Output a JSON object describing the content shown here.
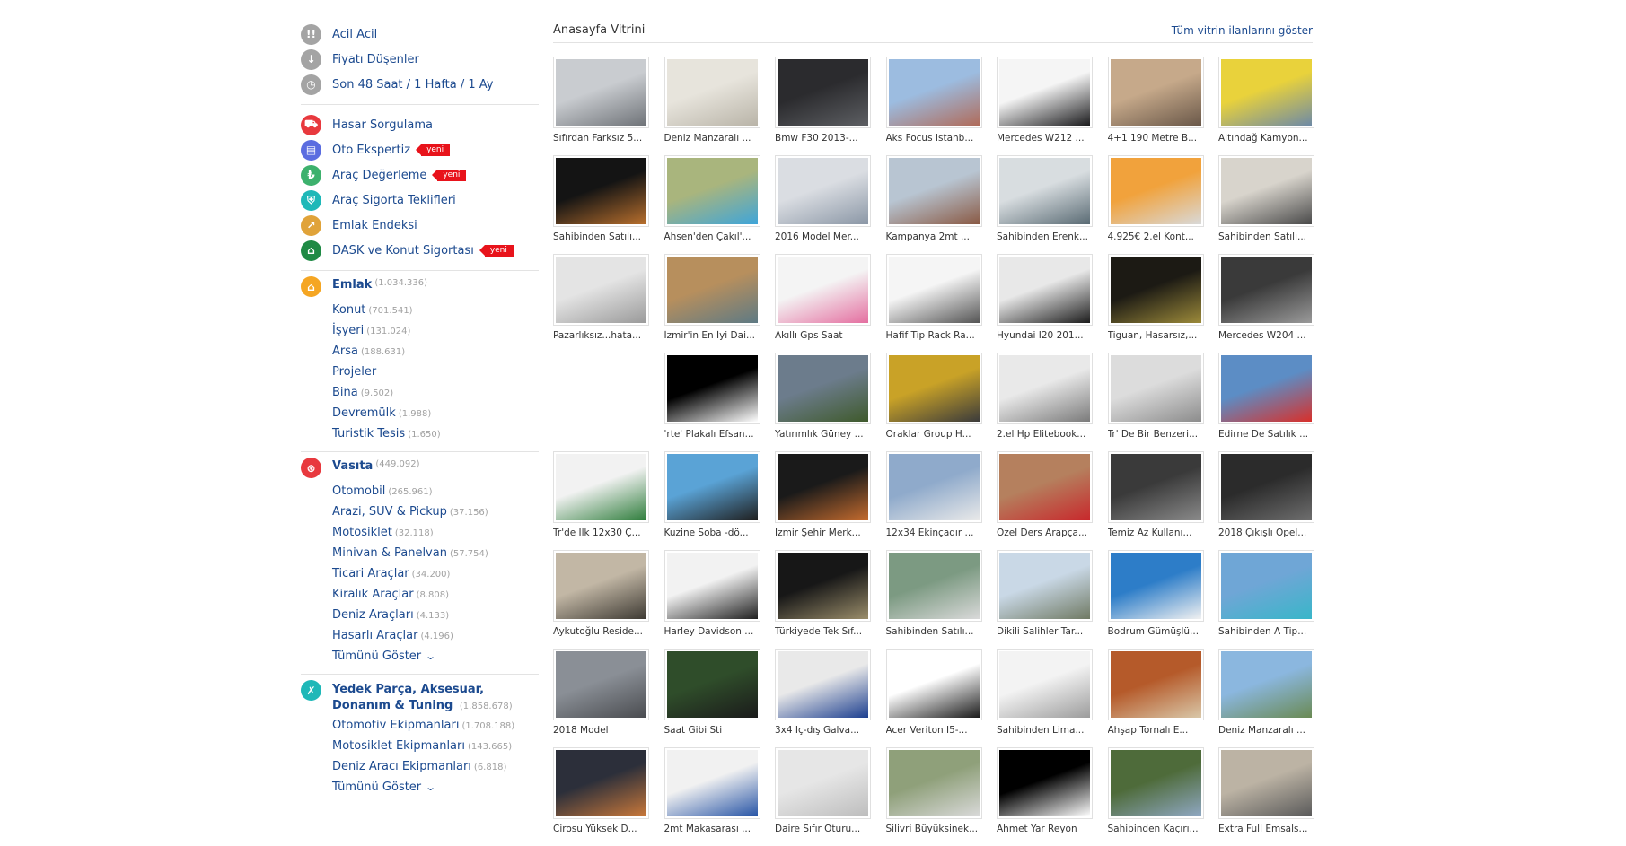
{
  "quick_links": [
    {
      "label": "Acil Acil",
      "icon": "exclamation-icon",
      "glyph": "!!",
      "color": "#a4a4a4"
    },
    {
      "label": "Fiyatı Düşenler",
      "icon": "arrow-down-icon",
      "glyph": "↓",
      "color": "#a4a4a4"
    },
    {
      "label": "Son 48 Saat / 1 Hafta / 1 Ay",
      "icon": "clock-icon",
      "glyph": "◷",
      "color": "#a4a4a4"
    }
  ],
  "services": [
    {
      "label": "Hasar Sorgulama",
      "icon": "car-damage-icon",
      "glyph": "⛟",
      "color": "#e8393e",
      "badge": ""
    },
    {
      "label": "Oto Ekspertiz",
      "icon": "car-report-icon",
      "glyph": "▤",
      "color": "#5b6de0",
      "badge": "yeni"
    },
    {
      "label": "Araç Değerleme",
      "icon": "car-value-icon",
      "glyph": "₺",
      "color": "#3db16d",
      "badge": "yeni"
    },
    {
      "label": "Araç Sigorta Teklifleri",
      "icon": "car-insurance-icon",
      "glyph": "⛨",
      "color": "#1fb8b8",
      "badge": ""
    },
    {
      "label": "Emlak Endeksi",
      "icon": "chart-icon",
      "glyph": "↗",
      "color": "#e0a33a",
      "badge": ""
    },
    {
      "label": "DASK ve Konut Sigortası",
      "icon": "house-shield-icon",
      "glyph": "⌂",
      "color": "#1f8a45",
      "badge": "yeni"
    }
  ],
  "categories": {
    "emlak": {
      "label": "Emlak",
      "count": "(1.034.336)",
      "icon": "home-icon",
      "glyph": "⌂",
      "color": "#f5a623",
      "items": [
        {
          "label": "Konut",
          "count": "(701.541)"
        },
        {
          "label": "İşyeri",
          "count": "(131.024)"
        },
        {
          "label": "Arsa",
          "count": "(188.631)"
        },
        {
          "label": "Projeler",
          "count": ""
        },
        {
          "label": "Bina",
          "count": "(9.502)"
        },
        {
          "label": "Devremülk",
          "count": "(1.988)"
        },
        {
          "label": "Turistik Tesis",
          "count": "(1.650)"
        }
      ]
    },
    "vasita": {
      "label": "Vasıta",
      "count": "(449.092)",
      "icon": "steering-wheel-icon",
      "glyph": "⊛",
      "color": "#e8393e",
      "items": [
        {
          "label": "Otomobil",
          "count": "(265.961)"
        },
        {
          "label": "Arazi, SUV & Pickup",
          "count": "(37.156)"
        },
        {
          "label": "Motosiklet",
          "count": "(32.118)"
        },
        {
          "label": "Minivan & Panelvan",
          "count": "(57.754)"
        },
        {
          "label": "Ticari Araçlar",
          "count": "(34.200)"
        },
        {
          "label": "Kiralık Araçlar",
          "count": "(8.808)"
        },
        {
          "label": "Deniz Araçları",
          "count": "(4.133)"
        },
        {
          "label": "Hasarlı Araçlar",
          "count": "(4.196)"
        }
      ],
      "show_all": "Tümünü Göster"
    },
    "yedek": {
      "label_line1": "Yedek Parça, Aksesuar,",
      "label_line2": "Donanım & Tuning",
      "count": "(1.858.678)",
      "icon": "wrench-icon",
      "glyph": "✗",
      "color": "#1fb8b8",
      "items": [
        {
          "label": "Otomotiv Ekipmanları",
          "count": "(1.708.188)"
        },
        {
          "label": "Motosiklet Ekipmanları",
          "count": "(143.665)"
        },
        {
          "label": "Deniz Aracı Ekipmanları",
          "count": "(6.818)"
        }
      ],
      "show_all": "Tümünü Göster"
    }
  },
  "showcase": {
    "title": "Anasayfa Vitrini",
    "show_all_link": "Tüm vitrin ilanlarını göster",
    "items": [
      {
        "title": "Sıfırdan Farksız 5...",
        "colors": [
          "#c9ccd0",
          "#6f7378"
        ]
      },
      {
        "title": "Deniz Manzaralı ...",
        "colors": [
          "#e7e4dc",
          "#b9b4a8"
        ]
      },
      {
        "title": "Bmw F30 2013-...",
        "colors": [
          "#2b2b2e",
          "#5d5f63"
        ]
      },
      {
        "title": "Aks Focus Istanb...",
        "colors": [
          "#9cbce0",
          "#b06b5a"
        ]
      },
      {
        "title": "Mercedes W212 ...",
        "colors": [
          "#f5f5f5",
          "#1b1b1d"
        ]
      },
      {
        "title": "4+1 190 Metre B...",
        "colors": [
          "#c6a98a",
          "#6a5849"
        ]
      },
      {
        "title": "Altındağ Kamyon...",
        "colors": [
          "#e9d23b",
          "#6e8aa6"
        ]
      },
      {
        "title": "Sahibinden Satılı...",
        "colors": [
          "#141414",
          "#b86f2d"
        ]
      },
      {
        "title": "Ahsen'den Çakıl'...",
        "colors": [
          "#a9b57d",
          "#3fa5d9"
        ]
      },
      {
        "title": "2016 Model Mer...",
        "colors": [
          "#dadde2",
          "#8b97a6"
        ]
      },
      {
        "title": "Kampanya 2mt ...",
        "colors": [
          "#b8c5d2",
          "#8a5a45"
        ]
      },
      {
        "title": "Sahibinden Erenk...",
        "colors": [
          "#d8dde0",
          "#5a6b74"
        ]
      },
      {
        "title": "4.925€ 2.el Kont...",
        "colors": [
          "#f1a23c",
          "#d9d9d9"
        ]
      },
      {
        "title": "Sahibinden Satılı...",
        "colors": [
          "#d8d4cc",
          "#4a4a4a"
        ]
      },
      {
        "title": "Pazarlıksız...hata...",
        "colors": [
          "#e4e4e4",
          "#9a9a9a"
        ]
      },
      {
        "title": "İzmir'in En İyi Dai...",
        "colors": [
          "#b78f5d",
          "#5e7a84"
        ]
      },
      {
        "title": "Akıllı Gps Saat",
        "colors": [
          "#f4f4f4",
          "#e46fa0"
        ]
      },
      {
        "title": "Hafif Tip Rack Ra...",
        "colors": [
          "#f5f5f5",
          "#555555"
        ]
      },
      {
        "title": "Hyundai I20 201...",
        "colors": [
          "#e8e8e8",
          "#1d1d1d"
        ]
      },
      {
        "title": "Tiguan, Hasarsız,...",
        "colors": [
          "#1c1a14",
          "#9c8a3a"
        ]
      },
      {
        "title": "Mercedes W204 ...",
        "colors": [
          "#3a3a3a",
          "#9a9a9a"
        ]
      },
      {
        "title": "",
        "colors": [
          "#ffffff",
          "#ffffff"
        ],
        "empty": true
      },
      {
        "title": "'rte' Plakalı Efsan...",
        "colors": [
          "#000000",
          "#ffffff"
        ]
      },
      {
        "title": "Yatırımlık Güney ...",
        "colors": [
          "#6c7c8c",
          "#3f5a2c"
        ]
      },
      {
        "title": "Oraklar Group H...",
        "colors": [
          "#c9a227",
          "#3b3b3b"
        ]
      },
      {
        "title": "2.el Hp Elitebook...",
        "colors": [
          "#e9e9e9",
          "#7b7b7b"
        ]
      },
      {
        "title": "Tr' De Bir Benzeri...",
        "colors": [
          "#dcdcdc",
          "#8c8c8c"
        ]
      },
      {
        "title": "Edirne De Satılık ...",
        "colors": [
          "#5c8dc5",
          "#d8302b"
        ]
      },
      {
        "title": "Tr'de Ilk 12x30 Ç...",
        "colors": [
          "#f2f2f2",
          "#2f7d3c"
        ]
      },
      {
        "title": "Kuzine Soba -dö...",
        "colors": [
          "#5aa3d6",
          "#1f1f1f"
        ]
      },
      {
        "title": "İzmir Şehir Merk...",
        "colors": [
          "#1a1a1a",
          "#c46b2e"
        ]
      },
      {
        "title": "12x34 Ekinçadır ...",
        "colors": [
          "#8faacb",
          "#e9e9e9"
        ]
      },
      {
        "title": "Özel Ders Arapça...",
        "colors": [
          "#b5805e",
          "#c8282c"
        ]
      },
      {
        "title": "Temiz Az Kullanı...",
        "colors": [
          "#3a3a3a",
          "#8a8a8a"
        ]
      },
      {
        "title": "2018 Çıkışlı Opel...",
        "colors": [
          "#2b2b2b",
          "#6e6e6e"
        ]
      },
      {
        "title": "Aykutoğlu Reside...",
        "colors": [
          "#c2b7a5",
          "#3e3a33"
        ]
      },
      {
        "title": "Harley Davidson ...",
        "colors": [
          "#f2f2f2",
          "#202020"
        ]
      },
      {
        "title": "Türkiyede Tek Sıf...",
        "colors": [
          "#171717",
          "#9a8d6a"
        ]
      },
      {
        "title": "Sahibinden Satılı...",
        "colors": [
          "#7c9a82",
          "#d9d9d9"
        ]
      },
      {
        "title": "Dikili Salihler Tar...",
        "colors": [
          "#c9d8e6",
          "#707a64"
        ]
      },
      {
        "title": "Bodrum Gümüşlü...",
        "colors": [
          "#2d7dc8",
          "#f1f1f1"
        ]
      },
      {
        "title": "Sahibinden A Tip...",
        "colors": [
          "#6fa6d6",
          "#39b6c9"
        ]
      },
      {
        "title": "2018 Model",
        "colors": [
          "#8a8f96",
          "#4a4c50"
        ]
      },
      {
        "title": "Saat Gibi Sti",
        "colors": [
          "#2f4d2a",
          "#1b1b1b"
        ]
      },
      {
        "title": "3x4 Iç-dış Galva...",
        "colors": [
          "#e9e9e9",
          "#1d3f8f"
        ]
      },
      {
        "title": "Acer Veriton I5-...",
        "colors": [
          "#ffffff",
          "#1b1b1b"
        ]
      },
      {
        "title": "Sahibinden Lima...",
        "colors": [
          "#f3f3f3",
          "#9c9c9c"
        ]
      },
      {
        "title": "Ahşap Tornalı E...",
        "colors": [
          "#b55a2a",
          "#d9c7a8"
        ]
      },
      {
        "title": "Deniz Manzaralı ...",
        "colors": [
          "#8bb7df",
          "#6a8a54"
        ]
      },
      {
        "title": "Cirosu Yüksek D...",
        "colors": [
          "#2c2f3a",
          "#c9783a"
        ]
      },
      {
        "title": "2mt Makasarası ...",
        "colors": [
          "#f1f1f1",
          "#2855a6"
        ]
      },
      {
        "title": "Daire Sıfır Oturu...",
        "colors": [
          "#e6e6e6",
          "#bdbdbd"
        ]
      },
      {
        "title": "Silivri Büyüksinek...",
        "colors": [
          "#8fa07a",
          "#d9d9d9"
        ]
      },
      {
        "title": "Ahmet Yar Reyon",
        "colors": [
          "#000000",
          "#ffffff"
        ]
      },
      {
        "title": "Sahibinden Kaçırı...",
        "colors": [
          "#4e6b3a",
          "#8fa7c2"
        ]
      },
      {
        "title": "Extra Full Emsals...",
        "colors": [
          "#bcb3a4",
          "#5a5a5a"
        ]
      }
    ]
  }
}
